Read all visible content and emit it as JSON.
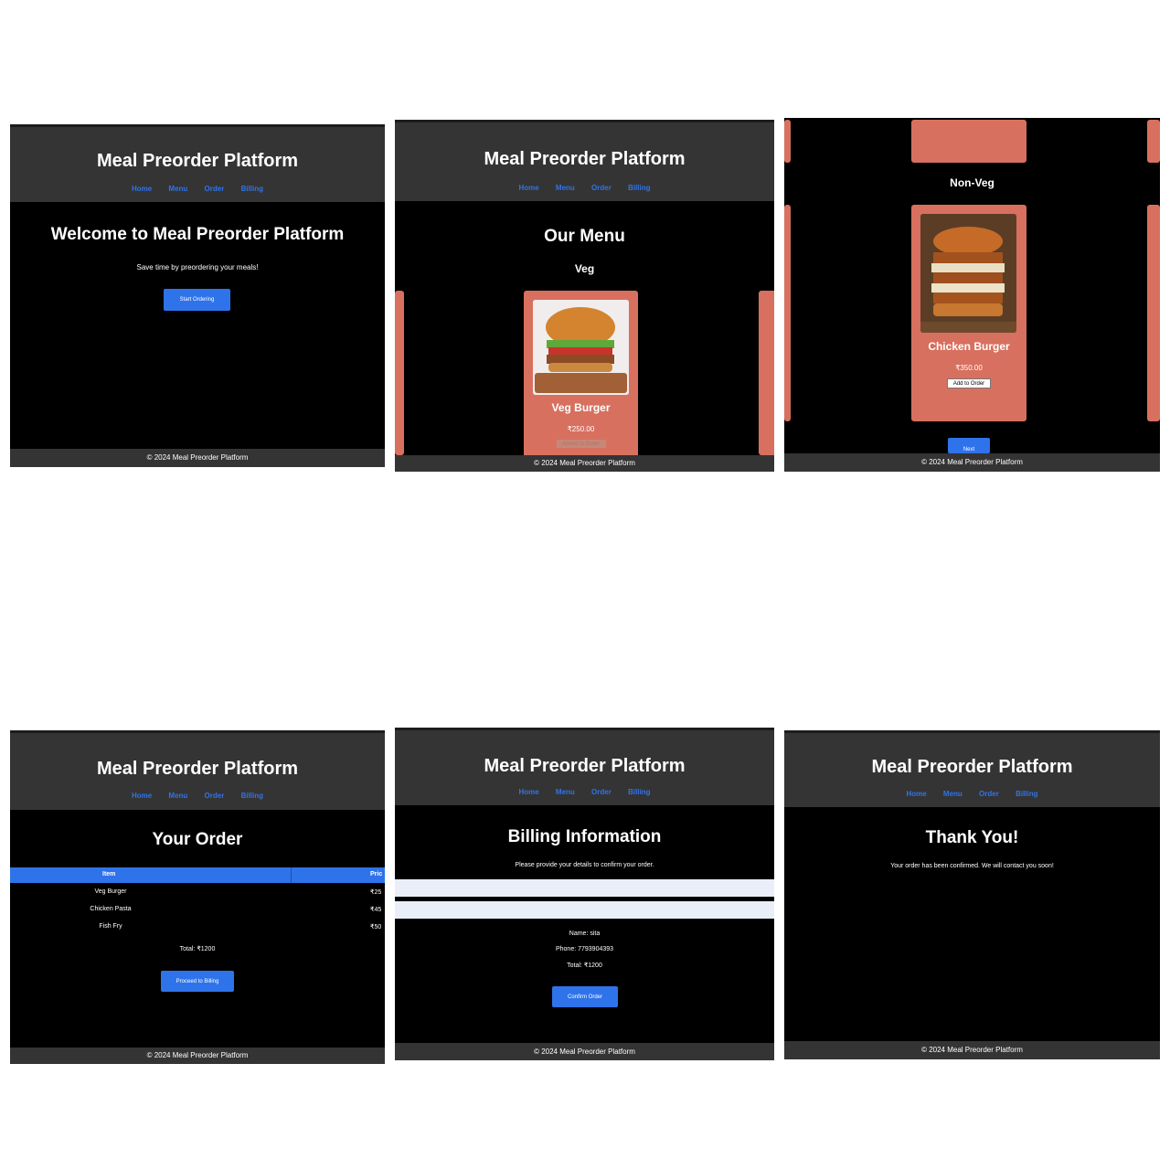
{
  "brand": "Meal Preorder Platform",
  "nav": [
    "Home",
    "Menu",
    "Order",
    "Billing"
  ],
  "footer": "© 2024 Meal Preorder Platform",
  "home": {
    "title": "Welcome to Meal Preorder Platform",
    "subtitle": "Save time by preordering your meals!",
    "button": "Start Ordering"
  },
  "menu": {
    "title": "Our Menu",
    "category": "Veg",
    "item": {
      "name": "Veg Burger",
      "price": "₹250.00",
      "button": "Added to Order"
    }
  },
  "nonveg": {
    "category": "Non-Veg",
    "item": {
      "name": "Chicken Burger",
      "price": "₹350.00",
      "button": "Add to Order"
    },
    "next_button": "Next"
  },
  "order": {
    "title": "Your Order",
    "columns": [
      "Item",
      "Pric"
    ],
    "rows": [
      {
        "item": "Veg Burger",
        "price": "₹25"
      },
      {
        "item": "Chicken Pasta",
        "price": "₹45"
      },
      {
        "item": "Fish Fry",
        "price": "₹50"
      }
    ],
    "total": "Total: ₹1200",
    "button": "Proceed to Billing"
  },
  "billing": {
    "title": "Billing Information",
    "subtitle": "Please provide your details to confirm your order.",
    "name": "Name: sita",
    "phone": "Phone: 7793904393",
    "total": "Total: ₹1200",
    "button": "Confirm Order"
  },
  "thanks": {
    "title": "Thank You!",
    "message": "Your order has been confirmed. We will contact you soon!"
  },
  "colors": {
    "accent": "#2f73ea",
    "card": "#d8705f",
    "header": "#343434",
    "background": "#000000"
  }
}
